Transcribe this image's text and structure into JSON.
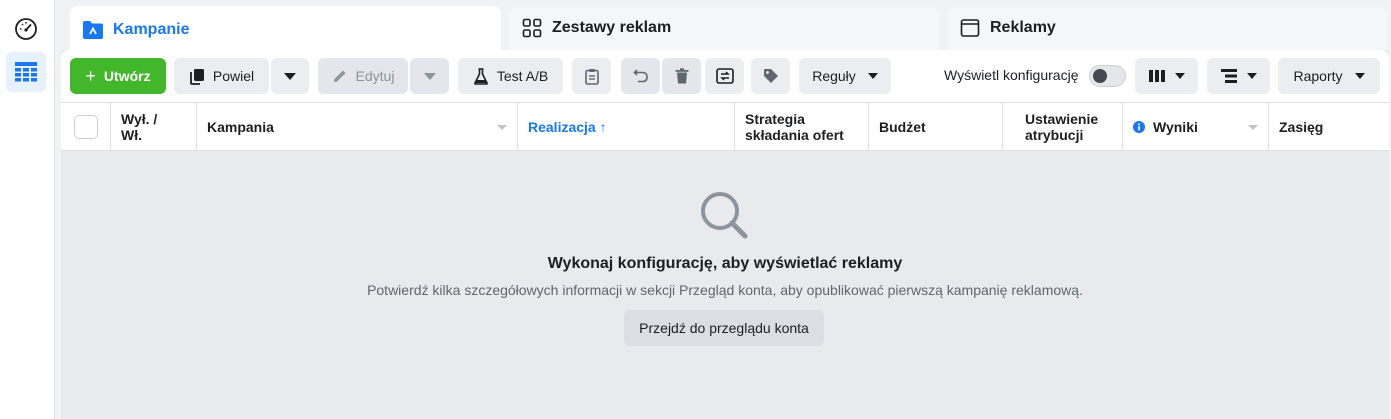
{
  "tabs": [
    {
      "label": "Kampanie",
      "icon": "folder-icon",
      "active": true
    },
    {
      "label": "Zestawy reklam",
      "icon": "grid-icon",
      "active": false
    },
    {
      "label": "Reklamy",
      "icon": "window-icon",
      "active": false
    }
  ],
  "toolbar": {
    "create_label": "Utwórz",
    "duplicate_label": "Powiel",
    "edit_label": "Edytuj",
    "ab_test_label": "Test A/B",
    "rules_label": "Reguły",
    "show_setup_label": "Wyświetl konfigurację",
    "reports_label": "Raporty"
  },
  "table": {
    "columns": [
      {
        "id": "onoff",
        "label": "Wył. / Wł."
      },
      {
        "id": "campaign",
        "label": "Kampania"
      },
      {
        "id": "delivery",
        "label": "Realizacja ↑"
      },
      {
        "id": "bid",
        "label": "Strategia składania ofert"
      },
      {
        "id": "budget",
        "label": "Budżet"
      },
      {
        "id": "attribution",
        "label": "Ustawienie atrybucji"
      },
      {
        "id": "results",
        "label": "Wyniki"
      },
      {
        "id": "reach",
        "label": "Zasięg"
      }
    ]
  },
  "empty_state": {
    "title": "Wykonaj konfigurację, aby wyświetlać reklamy",
    "description": "Potwierdź kilka szczegółowych informacji w sekcji Przegląd konta, aby opublikować pierwszą kampanię reklamową.",
    "button_label": "Przejdź do przeglądu konta"
  },
  "colors": {
    "accent": "#1877f2",
    "create_green": "#42b72a",
    "panel_bg": "#e9eaed"
  }
}
